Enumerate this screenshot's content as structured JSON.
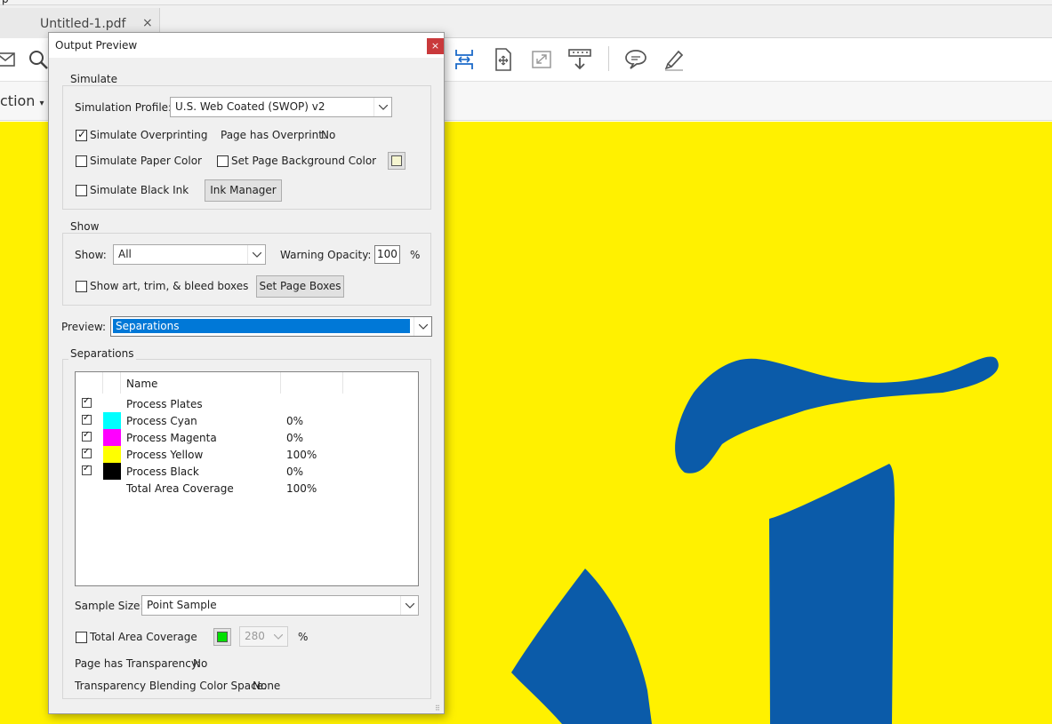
{
  "app": {
    "menu_fragment": "p",
    "tab": {
      "title": "Untitled-1.pdf",
      "close": "×"
    },
    "secondbar_fragment": "ction",
    "toolbar_icons": [
      "mail-icon",
      "search-icon",
      "fit-width-icon",
      "page-move-icon",
      "full-screen-icon",
      "read-mode-icon",
      "comment-icon",
      "highlight-pen-icon"
    ],
    "canvas_color": "#fff100",
    "artwork_color": "#0b5ba9"
  },
  "dialog": {
    "title": "Output Preview",
    "close": "×",
    "simulate": {
      "title": "Simulate",
      "profile_label": "Simulation Profile:",
      "profile_value": "U.S. Web Coated (SWOP) v2",
      "overprinting_label": "Simulate Overprinting",
      "overprinting_checked": true,
      "page_overprint_label": "Page has Overprint:",
      "page_overprint_value": "No",
      "paper_color_label": "Simulate Paper Color",
      "paper_color_checked": false,
      "bg_color_label": "Set Page Background Color",
      "bg_color_checked": false,
      "black_ink_label": "Simulate Black Ink",
      "black_ink_checked": false,
      "ink_manager_label": "Ink Manager"
    },
    "show": {
      "title": "Show",
      "show_label": "Show:",
      "show_value": "All",
      "warning_opacity_label": "Warning Opacity:",
      "warning_opacity_value": "100",
      "percent": "%",
      "boxes_label": "Show art, trim, & bleed boxes",
      "boxes_checked": false,
      "set_page_boxes_label": "Set Page Boxes"
    },
    "preview": {
      "label": "Preview:",
      "value": "Separations"
    },
    "separations": {
      "title": "Separations",
      "column_name": "Name",
      "rows": [
        {
          "checked": true,
          "name": "Process Plates",
          "value": "",
          "color": ""
        },
        {
          "checked": true,
          "name": "Process Cyan",
          "value": "0%",
          "color": "#00ffff"
        },
        {
          "checked": true,
          "name": "Process Magenta",
          "value": "0%",
          "color": "#ff00ff"
        },
        {
          "checked": true,
          "name": "Process Yellow",
          "value": "100%",
          "color": "#ffff00"
        },
        {
          "checked": true,
          "name": "Process Black",
          "value": "0%",
          "color": "#000000"
        },
        {
          "checked": false,
          "name": "Total Area Coverage",
          "value": "100%",
          "color": ""
        }
      ],
      "sample_size_label": "Sample Size:",
      "sample_size_value": "Point Sample",
      "tac_label": "Total Area Coverage",
      "tac_checked": false,
      "tac_color": "#00e000",
      "tac_value": "280",
      "tac_percent": "%",
      "transparency_label": "Page has Transparency:",
      "transparency_value": "No",
      "blending_label": "Transparency Blending Color Space:",
      "blending_value": "None"
    }
  }
}
